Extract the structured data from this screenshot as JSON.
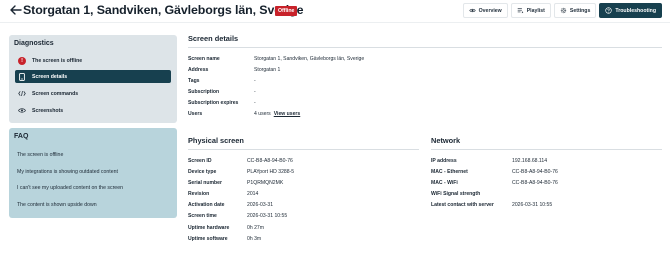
{
  "header": {
    "title": "Storgatan 1, Sandviken, Gävleborgs län, Sverige",
    "status_badge": "Offline",
    "status_color": "#c8222a",
    "nav": [
      {
        "label": "Overview",
        "icon": "eye-icon",
        "active": false
      },
      {
        "label": "Playlist",
        "icon": "playlist-icon",
        "active": false
      },
      {
        "label": "Settings",
        "icon": "gear-icon",
        "active": false
      },
      {
        "label": "Troubleshooting",
        "icon": "help-circle-icon",
        "active": true
      }
    ]
  },
  "diagnostics": {
    "title": "Diagnostics",
    "items": [
      {
        "label": "The screen is offline",
        "icon": "warning-icon"
      },
      {
        "label": "Screen details",
        "icon": "device-icon",
        "selected": true
      },
      {
        "label": "Screen commands",
        "icon": "code-icon"
      },
      {
        "label": "Screenshots",
        "icon": "eye-icon"
      }
    ]
  },
  "faq": {
    "title": "FAQ",
    "items": [
      "The screen is offline",
      "My integrations is showing outdated content",
      "I can't see my uploaded content on the screen",
      "The content is shown upside down"
    ]
  },
  "screen_details": {
    "title": "Screen details",
    "rows": [
      {
        "label": "Screen name",
        "value": "Storgatan 1, Sandviken, Gävleborgs län, Sverige"
      },
      {
        "label": "Address",
        "value": "Storgatan 1"
      },
      {
        "label": "Tags",
        "value": "-"
      },
      {
        "label": "Subscription",
        "value": "-"
      },
      {
        "label": "Subscription expires",
        "value": "-"
      },
      {
        "label": "Users",
        "value": "4 users",
        "link": "View users"
      }
    ]
  },
  "physical_screen": {
    "title": "Physical screen",
    "rows": [
      {
        "label": "Screen ID",
        "value": "CC-B8-A8-94-B0-76"
      },
      {
        "label": "Device type",
        "value": "PLAYport HD 3288-5"
      },
      {
        "label": "Serial number",
        "value": "P1QRMQN2MK"
      },
      {
        "label": "Revision",
        "value": "2014"
      },
      {
        "label": "Activation date",
        "value": "2026-03-31"
      },
      {
        "label": "Screen time",
        "value": "2026-03-31 10:55"
      },
      {
        "label": "Uptime hardware",
        "value": "0h 27m"
      },
      {
        "label": "Uptime software",
        "value": "0h 3m"
      }
    ]
  },
  "network": {
    "title": "Network",
    "rows": [
      {
        "label": "IP address",
        "value": "192.168.68.114"
      },
      {
        "label": "MAC - Ethernet",
        "value": "CC-B8-A8-94-B0-76"
      },
      {
        "label": "MAC - WiFi",
        "value": "CC-B8-A8-94-B0-76"
      },
      {
        "label": "WiFi Signal strength",
        "value": ""
      },
      {
        "label": "Latest contact with server",
        "value": "2026-03-31 10:55"
      }
    ]
  }
}
